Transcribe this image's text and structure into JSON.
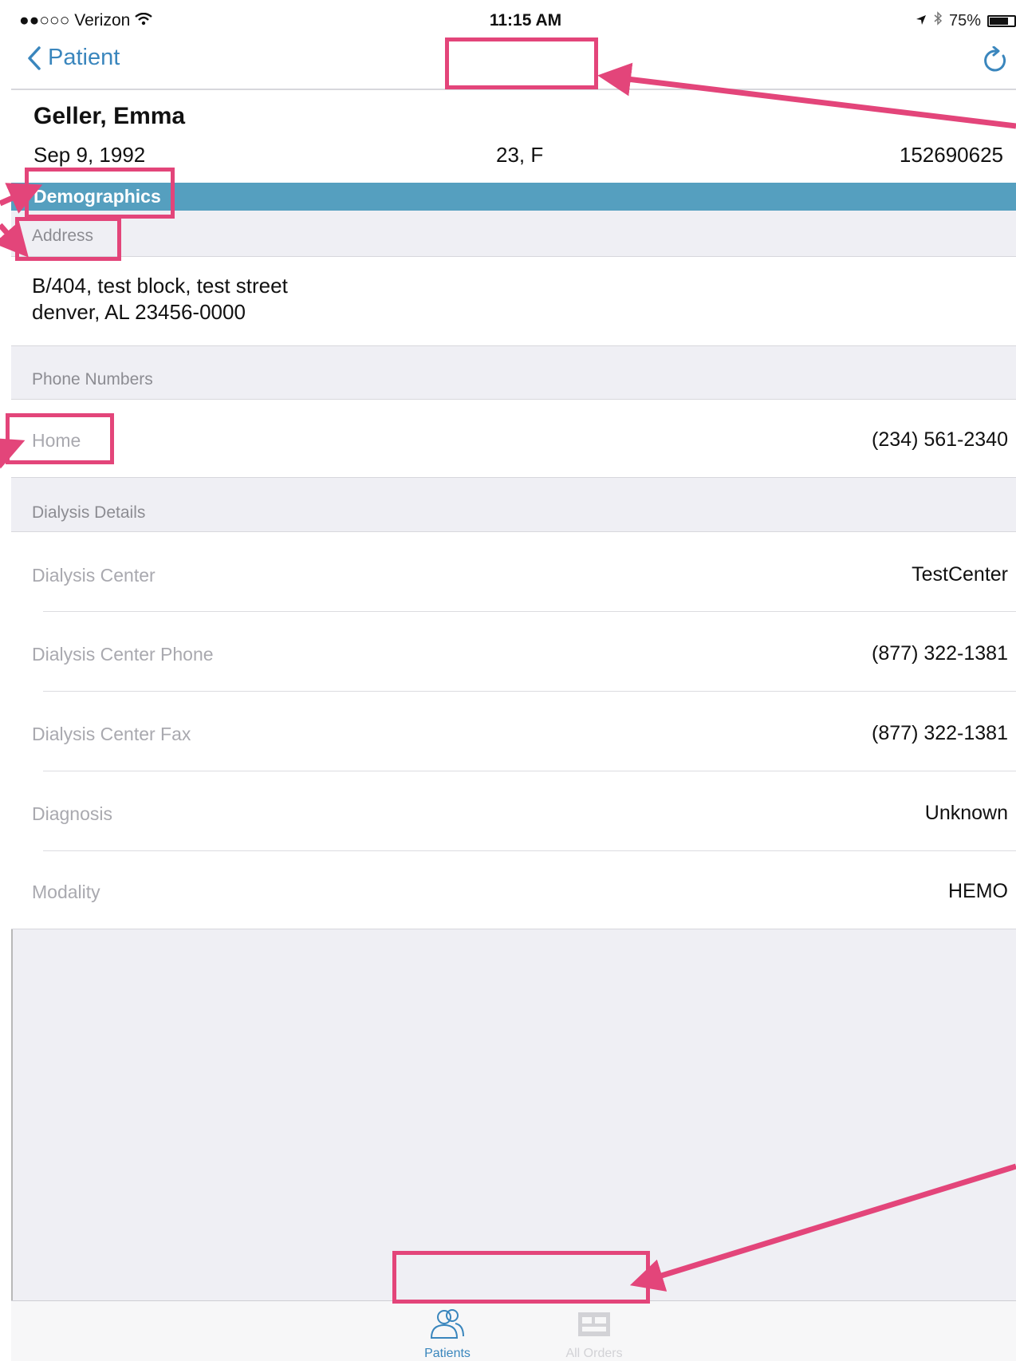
{
  "status_bar": {
    "carrier": "●●○○○ Verizon",
    "time": "11:15 AM",
    "battery_percent": "75%",
    "battery_level": 0.75
  },
  "nav": {
    "back_label": "Patient",
    "title": "",
    "refresh_icon": "refresh-icon"
  },
  "patient": {
    "name": "Geller, Emma",
    "dob": "Sep 9, 1992",
    "age_sex": "23, F",
    "id": "152690625"
  },
  "section_title": "Demographics",
  "address": {
    "header": "Address",
    "line1": "B/404, test block, test street",
    "line2": "denver, AL 23456-0000"
  },
  "phone": {
    "header": "Phone Numbers",
    "label": "Home",
    "value": "(234) 561-2340"
  },
  "dialysis": {
    "header": "Dialysis Details",
    "rows": [
      {
        "label": "Dialysis Center",
        "value": "TestCenter"
      },
      {
        "label": "Dialysis Center Phone",
        "value": "(877) 322-1381"
      },
      {
        "label": "Dialysis Center Fax",
        "value": "(877) 322-1381"
      },
      {
        "label": "Diagnosis",
        "value": "Unknown"
      },
      {
        "label": "Modality",
        "value": "HEMO"
      }
    ]
  },
  "tabs": [
    {
      "label": "Patients",
      "icon": "patients-icon",
      "active": true
    },
    {
      "label": "All Orders",
      "icon": "all-orders-icon",
      "active": false
    }
  ],
  "colors": {
    "accent": "#3a86bd",
    "section_bar": "#559fbf",
    "annotation": "#e3457a"
  }
}
